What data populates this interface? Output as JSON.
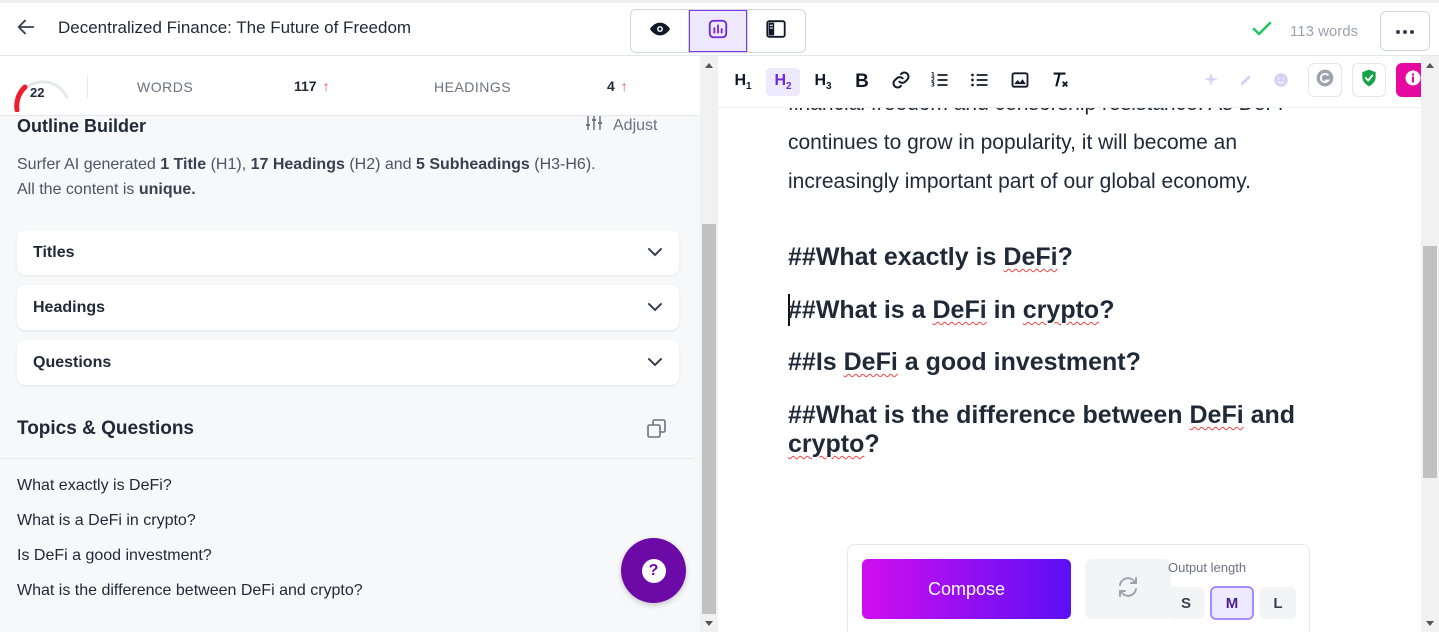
{
  "header": {
    "title": "Decentralized Finance: The Future of Freedom",
    "word_count": "113 words",
    "check_color": "#22c55e"
  },
  "stats": {
    "score": "22",
    "score_fraction": 0.22,
    "words_label": "WORDS",
    "words_value": "117",
    "headings_label": "HEADINGS",
    "headings_value": "4",
    "trend_icon": "arrow-up-icon"
  },
  "outline": {
    "title": "Outline Builder",
    "adjust_label": "Adjust",
    "desc_prefix": "Surfer AI generated ",
    "desc_title_count": "1 Title",
    "desc_h1": " (H1), ",
    "desc_headings_count": "17 Headings",
    "desc_h2": " (H2) and ",
    "desc_sub_count": "5 Subheadings",
    "desc_h3": " (H3-H6).",
    "desc_line2": "All the content is ",
    "desc_unique": "unique."
  },
  "accordions": [
    {
      "label": "Titles"
    },
    {
      "label": "Headings"
    },
    {
      "label": "Questions"
    }
  ],
  "topics": {
    "title": "Topics & Questions",
    "items": [
      "What exactly is DeFi?",
      "What is a DeFi in crypto?",
      "Is DeFi a good investment?",
      "What is the difference between DeFi and crypto?"
    ]
  },
  "help_label": "?",
  "toolbar": {
    "buttons": [
      "H1",
      "H2",
      "H3",
      "B",
      "link-icon",
      "ordered-list-icon",
      "bullet-list-icon",
      "image-icon",
      "clear-format-icon"
    ],
    "active": "H2"
  },
  "editor": {
    "partial_line": "financial freedom and censorship resistance. As DeFi",
    "para_line1": "continues to grow in popularity, it will become an",
    "para_line2": "increasingly important part of our global economy.",
    "h_hash": "##",
    "h1_a": "What exactly is ",
    "h1_sp": "DeFi",
    "h1_b": "?",
    "h2_a": "What is a ",
    "h2_sp1": "DeFi",
    "h2_mid": " in ",
    "h2_sp2": "crypto",
    "h2_b": "?",
    "h3_a": "Is ",
    "h3_sp": "DeFi",
    "h3_b": " a good investment?",
    "h4_a": "What is the difference between ",
    "h4_sp1": "DeFi",
    "h4_mid": " and",
    "h4_sp2": "crypto",
    "h4_b": "?"
  },
  "compose": {
    "button_label": "Compose",
    "output_label": "Output length",
    "sizes": [
      "S",
      "M",
      "L"
    ],
    "selected": "M"
  },
  "colors": {
    "accent": "#7c3aed",
    "brand_purple": "#6b0aa6",
    "info_pink": "#e5099f",
    "shield_green": "#16a34a",
    "error_red": "#ef4444"
  }
}
